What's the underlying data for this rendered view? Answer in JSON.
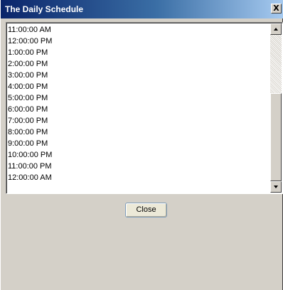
{
  "window": {
    "title": "The Daily Schedule",
    "close_glyph": "X"
  },
  "schedule": {
    "items": [
      "11:00:00 AM",
      "12:00:00 PM",
      "1:00:00 PM",
      "2:00:00 PM",
      "3:00:00 PM",
      "4:00:00 PM",
      "5:00:00 PM",
      "6:00:00 PM",
      "7:00:00 PM",
      "8:00:00 PM",
      "9:00:00 PM",
      "10:00:00 PM",
      "11:00:00 PM",
      "12:00:00 AM"
    ]
  },
  "footer": {
    "close_label": "Close"
  },
  "scrollbar": {
    "position": 1.0
  },
  "colors": {
    "titlebar_start": "#0a246a",
    "titlebar_end": "#a6caf0",
    "dialog_background": "#d4d0c8"
  }
}
